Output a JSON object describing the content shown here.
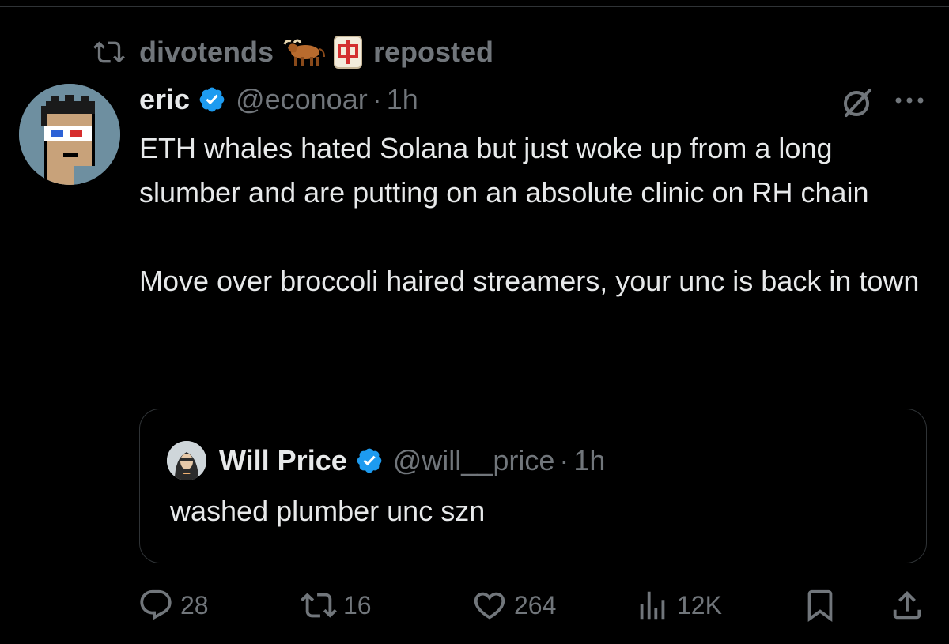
{
  "repost": {
    "user": "divotends",
    "emoji": "🐂🀄",
    "label": "reposted"
  },
  "tweet": {
    "display_name": "eric",
    "handle": "@econoar",
    "separator": "·",
    "time": "1h",
    "paragraphs": [
      "ETH whales hated Solana but just woke up from a long slumber and are putting on an absolute clinic on RH chain",
      "Move over broccoli haired streamers, your unc is back in town"
    ]
  },
  "quote": {
    "display_name": "Will Price",
    "handle": "@will__price",
    "separator": "·",
    "time": "1h",
    "text": "washed plumber unc szn"
  },
  "actions": {
    "replies": "28",
    "reposts": "16",
    "likes": "264",
    "views": "12K"
  },
  "icons": {
    "repost": "repost-icon",
    "verified": "verified-badge-icon",
    "grok": "grok-icon",
    "more": "more-icon",
    "reply": "reply-icon",
    "like": "heart-icon",
    "views": "views-icon",
    "bookmark": "bookmark-icon",
    "share": "share-icon"
  },
  "colors": {
    "background": "#000000",
    "text": "#e7e9ea",
    "secondary": "#71767b",
    "verified": "#1d9bf0",
    "border": "#2f3336"
  }
}
